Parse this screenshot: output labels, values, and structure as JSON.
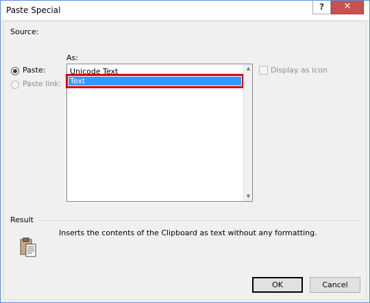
{
  "window": {
    "title": "Paste Special"
  },
  "titlebar": {
    "help_glyph": "?",
    "close_glyph": "✕"
  },
  "source": {
    "label": "Source:"
  },
  "as_label": "As:",
  "options": {
    "paste": {
      "label": "Paste:",
      "checked": true
    },
    "paste_link": {
      "label": "Paste link:",
      "checked": false,
      "disabled": true
    }
  },
  "list": {
    "items": [
      "Unicode Text",
      "Text"
    ],
    "selected_index": 1
  },
  "display_as_icon": {
    "label": "Display as icon",
    "checked": false,
    "disabled": true
  },
  "result": {
    "label": "Result",
    "description": "Inserts the contents of the Clipboard as text without any formatting."
  },
  "buttons": {
    "ok": "OK",
    "cancel": "Cancel"
  },
  "colors": {
    "selection": "#3399ff",
    "highlight_box": "#d40000",
    "close_button": "#c75050"
  },
  "icons": {
    "result_icon": "clipboard-paste-icon"
  }
}
